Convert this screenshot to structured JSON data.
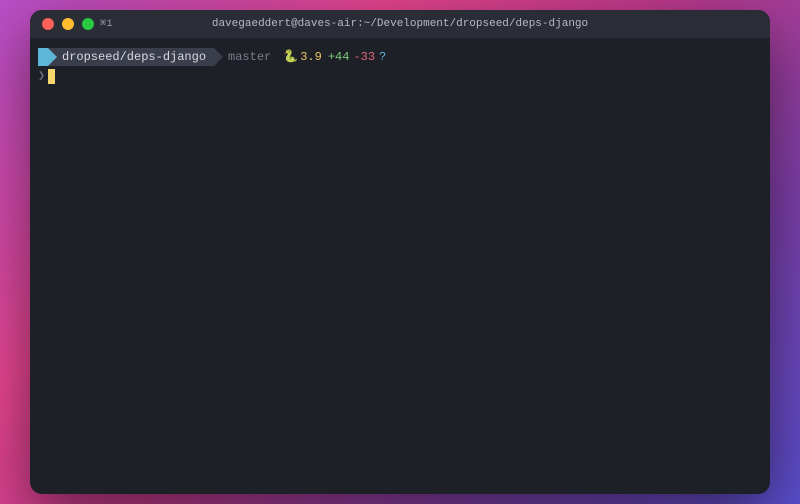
{
  "titlebar": {
    "tab_label": "⌘1",
    "title": "davegaeddert@daves-air:~/Development/dropseed/deps-django"
  },
  "prompt": {
    "path": "dropseed/deps-django",
    "branch": "master",
    "python_version": "3.9",
    "git_added": "+44",
    "git_deleted": "-33",
    "git_untracked": "?"
  },
  "input": {
    "prompt_char": "❯"
  }
}
